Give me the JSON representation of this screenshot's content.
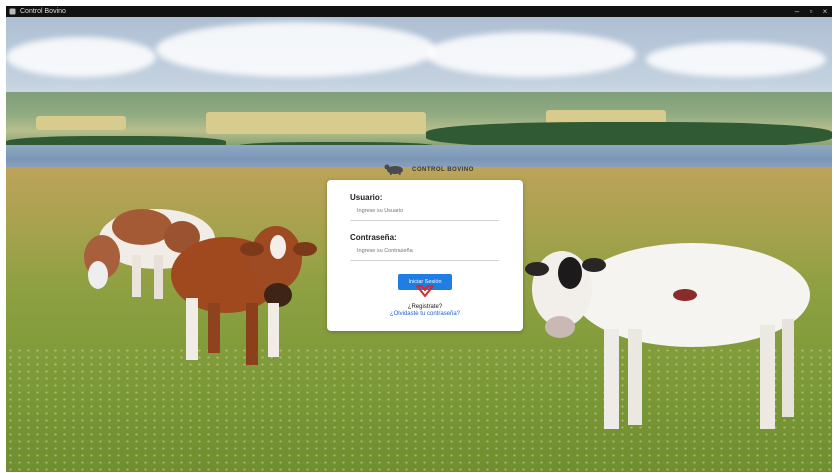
{
  "window": {
    "title": "Control Bovino",
    "controls": [
      "–",
      "▫",
      "×"
    ]
  },
  "brand": {
    "text": "CONTROL BOVINO"
  },
  "login": {
    "user_label": "Usuario:",
    "user_placeholder": "Ingrese su Usuario",
    "password_label": "Contraseña:",
    "password_placeholder": "Ingrese su Contraseña",
    "submit_label": "Iniciar Sesión",
    "register_link": "¿Registrate?",
    "forgot_link": "¿Olvidaste tu contraseña?"
  },
  "colors": {
    "primary": "#1f7de3",
    "link_register": "#1a1a1a",
    "link_forgot": "#1f5fd1",
    "cursor": "#d62b2b"
  },
  "icons": {
    "brand": "cow-logo-icon",
    "app": "app-icon",
    "cursor": "hand-pointer-icon"
  }
}
